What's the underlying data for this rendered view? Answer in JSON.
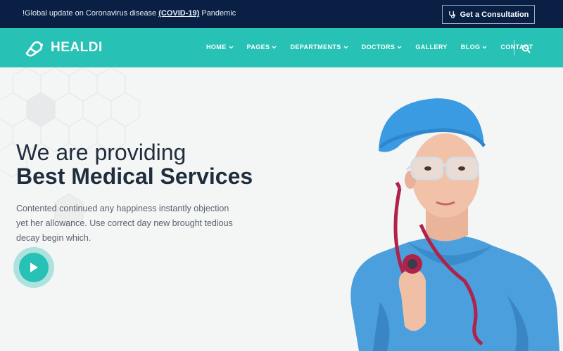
{
  "topbar": {
    "notice_prefix": "!Global update on Coronavirus disease ",
    "notice_highlight": "(COVID-19)",
    "notice_suffix": " Pandemic",
    "consult_label": "Get a Consultation",
    "consult_icon": "stethoscope-icon"
  },
  "nav": {
    "logo_text": "HEALDI",
    "logo_icon": "pill-icon",
    "items": [
      {
        "label": "HOME",
        "has_dropdown": true
      },
      {
        "label": "PAGES",
        "has_dropdown": true
      },
      {
        "label": "DEPARTMENTS",
        "has_dropdown": true
      },
      {
        "label": "DOCTORS",
        "has_dropdown": true
      },
      {
        "label": "GALLERY",
        "has_dropdown": false
      },
      {
        "label": "BLOG",
        "has_dropdown": true
      },
      {
        "label": "CONTACT",
        "has_dropdown": false
      }
    ],
    "search_icon": "search-icon"
  },
  "hero": {
    "line1": "We are providing",
    "line2": "Best Medical Services",
    "description": "Contented continued any happiness instantly objection yet her allowance. Use correct day new brought tedious decay begin which.",
    "play_icon": "play-icon"
  },
  "colors": {
    "topbar_bg": "#0a1f44",
    "accent": "#27c1b5",
    "heading": "#1f2d3d",
    "body_text": "#5a6472"
  }
}
